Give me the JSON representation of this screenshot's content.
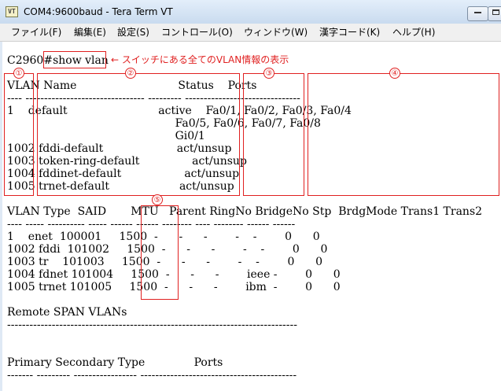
{
  "window": {
    "title": "COM4:9600baud - Tera Term VT",
    "app_icon": "VT"
  },
  "menu": [
    "ファイル(F)",
    "編集(E)",
    "設定(S)",
    "コントロール(O)",
    "ウィンドウ(W)",
    "漢字コード(K)",
    "ヘルプ(H)"
  ],
  "terminal": {
    "lines": [
      "C2960#show vlan",
      "",
      "VLAN Name                             Status    Ports",
      "---- -------------------------------- --------- -------------------------------",
      "1    default                          active    Fa0/1, Fa0/2, Fa0/3, Fa0/4",
      "                                                Fa0/5, Fa0/6, Fa0/7, Fa0/8",
      "                                                Gi0/1",
      "1002 fddi-default                     act/unsup",
      "1003 token-ring-default               act/unsup",
      "1004 fddinet-default                  act/unsup",
      "1005 trnet-default                    act/unsup",
      "",
      "VLAN Type  SAID       MTU   Parent RingNo BridgeNo Stp  BrdgMode Trans1 Trans2",
      "---- ----- ---------- ----- ------ ------ -------- ---- -------- ------ ------",
      "1    enet  100001     1500  -      -      -        -    -        0      0",
      "1002 fddi  101002     1500  -      -      -        -    -        0      0",
      "1003 tr    101003     1500  -      -      -        -    -        0      0",
      "1004 fdnet 101004     1500  -      -      -        ieee -        0      0",
      "1005 trnet 101005     1500  -      -      -        ibm  -        0      0",
      "",
      "Remote SPAN VLANs",
      "------------------------------------------------------------------------------",
      "",
      "",
      "Primary Secondary Type              Ports",
      "------- --------- ----------------- ------------------------------------------"
    ]
  },
  "annotations": {
    "note": "← スイッチにある全てのVLAN情報の表示",
    "markers": [
      "①",
      "②",
      "③",
      "④",
      "⑤"
    ]
  },
  "colors": {
    "annotation_red": "#e02020",
    "terminal_background": "#ffffff",
    "terminal_text": "#000000"
  }
}
